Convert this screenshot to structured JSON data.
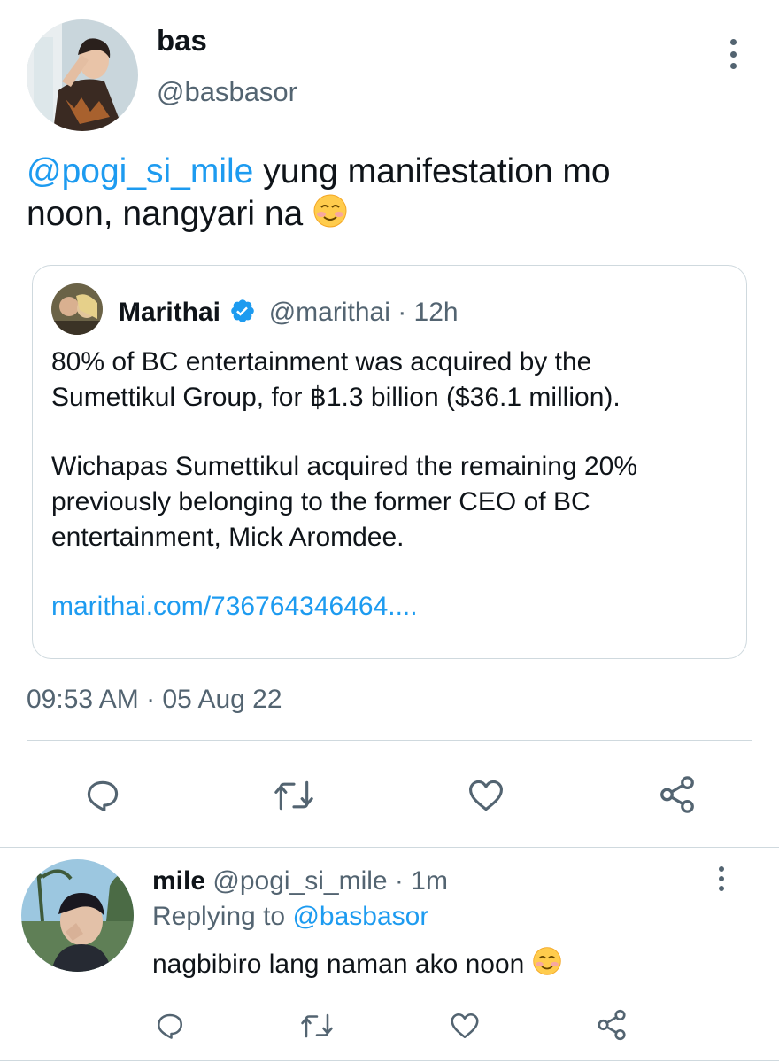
{
  "tweet": {
    "author": {
      "name": "bas",
      "handle": "@basbasor"
    },
    "text": {
      "mention": "@pogi_si_mile",
      "line1_rest": " yung manifestation mo",
      "line2": "noon, nangyari na"
    },
    "quote": {
      "author": {
        "name": "Marithai",
        "handle": "@marithai",
        "separator": " · ",
        "time": "12h"
      },
      "body_lines": [
        "80% of BC entertainment was acquired by the",
        "Sumettikul Group, for ฿1.3 billion ($36.1 million).",
        "Wichapas Sumettikul acquired the remaining 20%",
        "previously  belonging to the former CEO of BC",
        "entertainment, Mick Aromdee."
      ],
      "link": "marithai.com/736764346464...."
    },
    "timestamp": "09:53 AM · 05 Aug 22",
    "actions": [
      "reply-icon",
      "retweet-icon",
      "like-icon",
      "share-icon"
    ]
  },
  "reply": {
    "author": {
      "name": "mile",
      "handle": "@pogi_si_mile",
      "separator": " · ",
      "time": "1m"
    },
    "replying_to": {
      "label": "Replying to ",
      "handle": "@basbasor"
    },
    "text": "nagbibiro lang naman ako noon",
    "actions": [
      "reply-icon",
      "retweet-icon",
      "like-icon",
      "share-icon"
    ]
  },
  "colors": {
    "link": "#1d9bf0",
    "muted": "#536471",
    "text": "#0f1419",
    "verified": "#1d9bf0",
    "border": "#cfd9de"
  }
}
